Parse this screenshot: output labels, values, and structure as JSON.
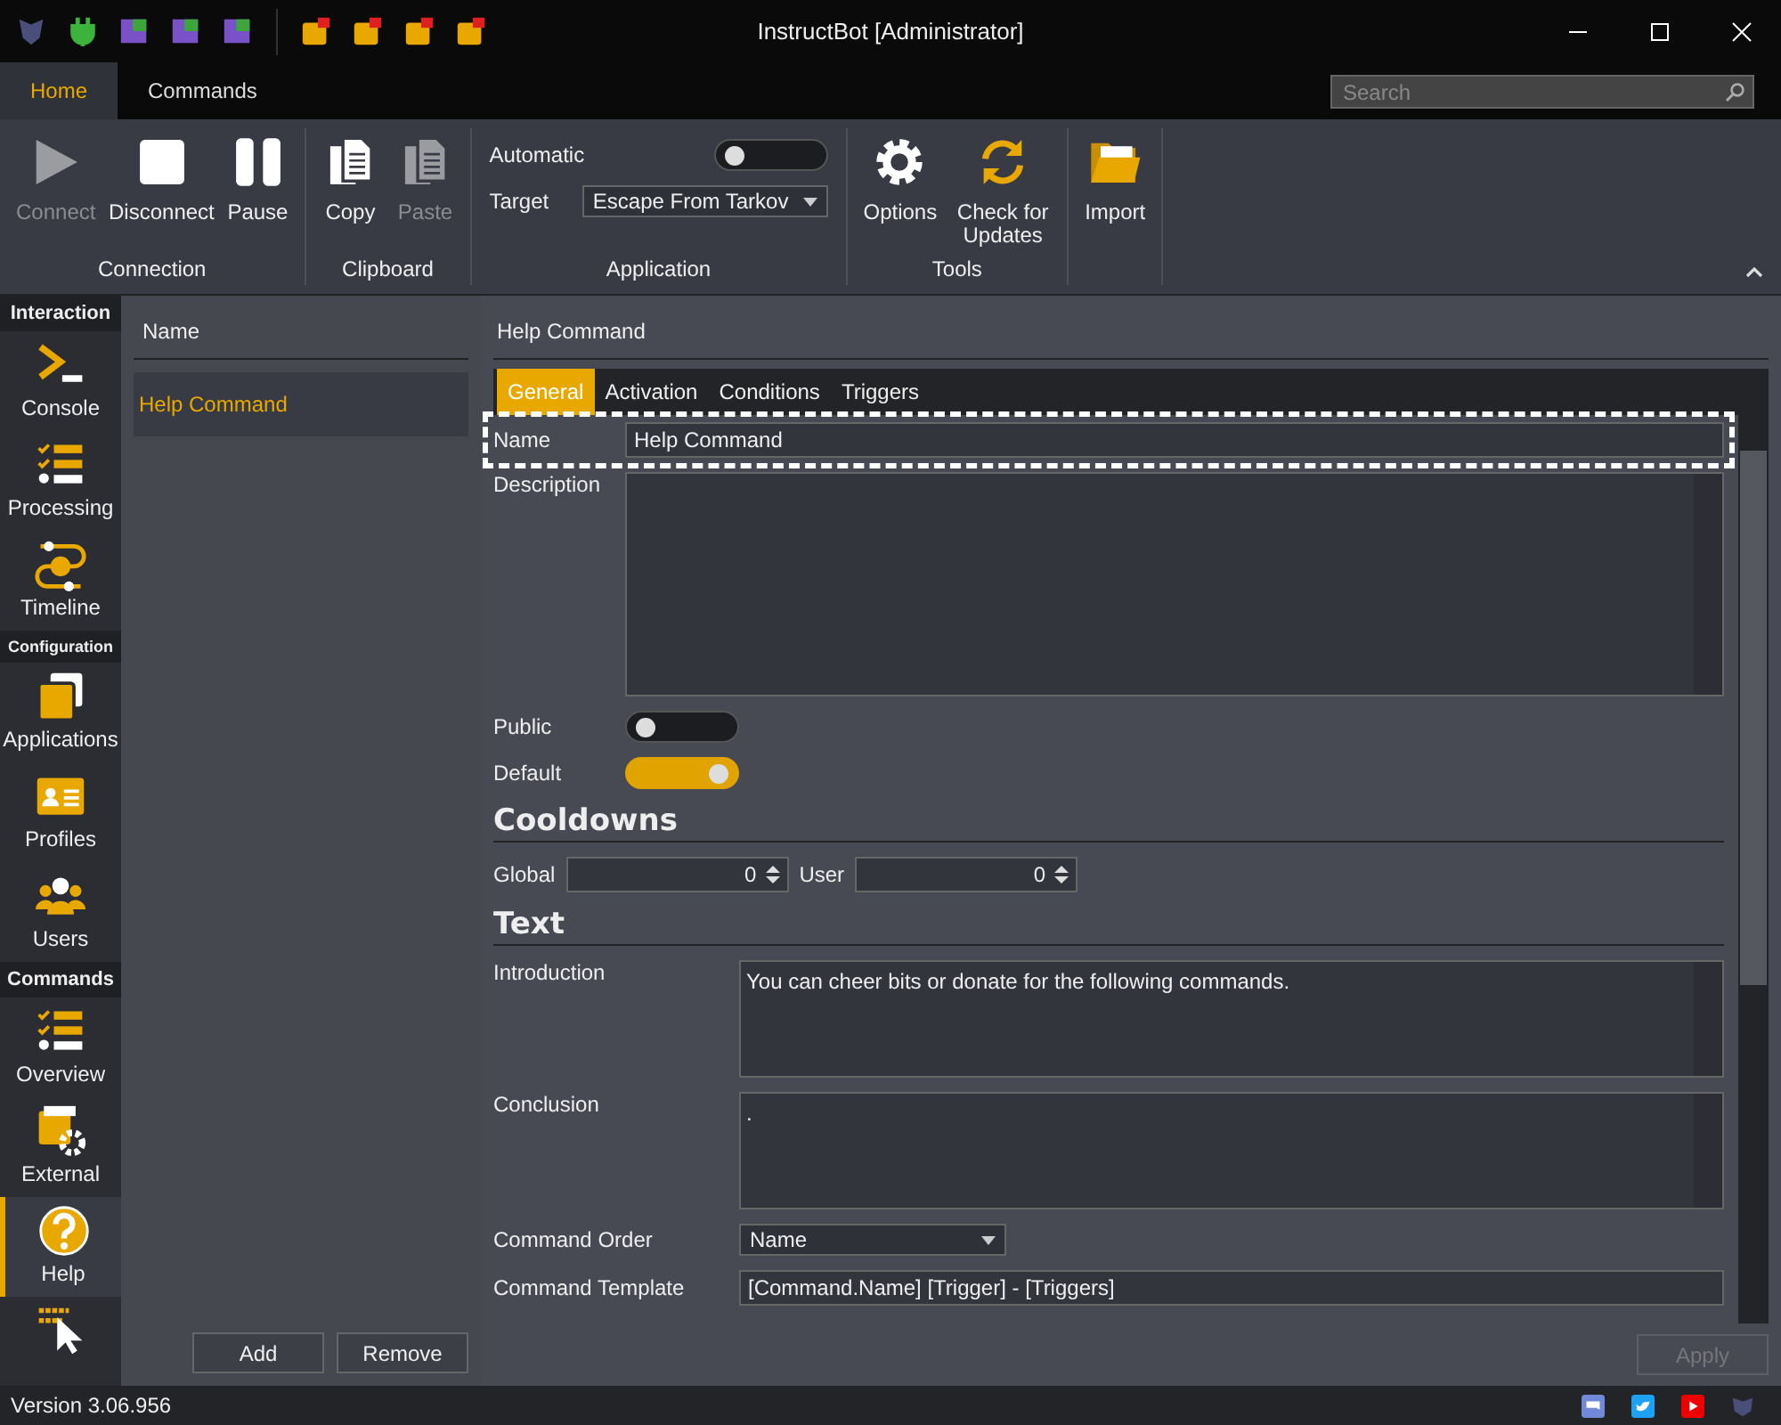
{
  "window": {
    "title": "InstructBot [Administrator]"
  },
  "ribbon_tabs": [
    {
      "label": "Home",
      "selected": true
    },
    {
      "label": "Commands",
      "selected": false
    }
  ],
  "search": {
    "placeholder": "Search"
  },
  "ribbon_groups": [
    {
      "label": "Connection",
      "items": [
        {
          "kind": "button",
          "label": "Connect",
          "disabled": true
        },
        {
          "kind": "button",
          "label": "Disconnect",
          "disabled": false
        },
        {
          "kind": "button",
          "label": "Pause",
          "disabled": false
        }
      ]
    },
    {
      "label": "Clipboard",
      "items": [
        {
          "kind": "button",
          "label": "Copy",
          "disabled": false
        },
        {
          "kind": "button",
          "label": "Paste",
          "disabled": true
        }
      ]
    },
    {
      "label": "Application",
      "items": [
        {
          "kind": "toggle",
          "label": "Automatic",
          "on": false
        },
        {
          "kind": "dropdown",
          "label": "Target",
          "value": "Escape From Tarkov"
        }
      ]
    },
    {
      "label": "Tools",
      "items": [
        {
          "kind": "button",
          "label": "Options",
          "disabled": false
        },
        {
          "kind": "button",
          "label": "Check for Updates",
          "disabled": false
        }
      ]
    },
    {
      "items": [
        {
          "kind": "button",
          "label": "Import",
          "disabled": false
        }
      ]
    }
  ],
  "sidebar": [
    {
      "header": "Interaction",
      "items": [
        {
          "label": "Console",
          "selected": false
        },
        {
          "label": "Processing",
          "selected": false
        },
        {
          "label": "Timeline",
          "selected": false
        }
      ]
    },
    {
      "header": "Configuration",
      "items": [
        {
          "label": "Applications",
          "selected": false
        },
        {
          "label": "Profiles",
          "selected": false
        },
        {
          "label": "Users",
          "selected": false
        }
      ]
    },
    {
      "header": "Commands",
      "items": [
        {
          "label": "Overview",
          "selected": false
        },
        {
          "label": "External",
          "selected": false
        },
        {
          "label": "Help",
          "selected": true
        },
        {
          "selected": false
        }
      ]
    }
  ],
  "list": {
    "column": "Name",
    "rows": [
      {
        "label": "Help Command",
        "selected": true
      }
    ],
    "buttons": [
      "Add",
      "Remove"
    ]
  },
  "detail": {
    "title": "Help Command",
    "tabs": [
      {
        "label": "General",
        "selected": true
      },
      {
        "label": "Activation",
        "selected": false
      },
      {
        "label": "Conditions",
        "selected": false
      },
      {
        "label": "Triggers",
        "selected": false
      }
    ],
    "name": {
      "label": "Name",
      "value": "Help Command",
      "highlighted": true
    },
    "description": {
      "label": "Description"
    },
    "toggles": [
      {
        "label": "Public",
        "on": false
      },
      {
        "label": "Default",
        "on": true
      }
    ],
    "cooldowns": {
      "heading": "Cooldowns",
      "global": {
        "label": "Global",
        "value": "0"
      },
      "user": {
        "label": "User",
        "value": "0"
      }
    },
    "text": {
      "heading": "Text",
      "introduction": {
        "label": "Introduction",
        "value": "You can cheer bits or donate for the following commands."
      },
      "conclusion": {
        "label": "Conclusion",
        "value": "."
      },
      "command_order": {
        "label": "Command Order",
        "value": "Name"
      },
      "command_template": {
        "label": "Command Template",
        "value": "[Command.Name] [Trigger] - [Triggers]"
      }
    },
    "apply": {
      "label": "Apply",
      "disabled": true
    }
  },
  "status_bar": {
    "version": "Version 3.06.956"
  }
}
